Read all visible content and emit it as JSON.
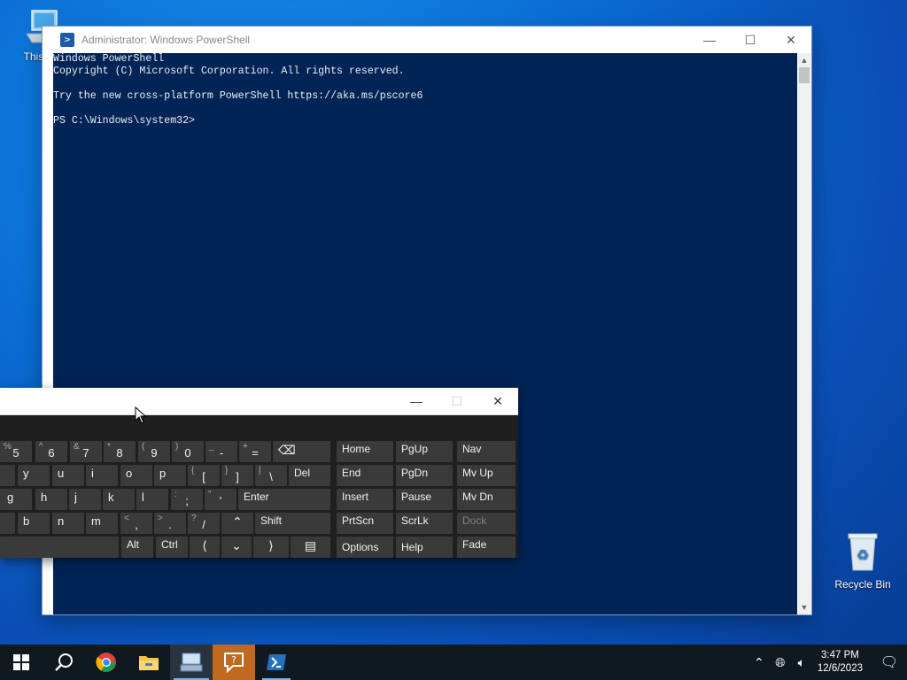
{
  "desktop": {
    "icons": [
      {
        "label": "This PC"
      },
      {
        "label": "Recycle Bin"
      }
    ]
  },
  "powershell": {
    "title": "Administrator: Windows PowerShell",
    "lines": [
      "Windows PowerShell",
      "Copyright (C) Microsoft Corporation. All rights reserved.",
      "",
      "Try the new cross-platform PowerShell https://aka.ms/pscore6",
      "",
      "PS C:\\Windows\\system32>"
    ]
  },
  "osk": {
    "keys": {
      "k5": {
        "shift": "%",
        "main": "5"
      },
      "k6": {
        "shift": "^",
        "main": "6"
      },
      "k7": {
        "shift": "&",
        "main": "7"
      },
      "k8": {
        "shift": "*",
        "main": "8"
      },
      "k9": {
        "shift": "(",
        "main": "9"
      },
      "k0": {
        "shift": ")",
        "main": "0"
      },
      "kminus": {
        "shift": "_",
        "main": "-"
      },
      "kequal": {
        "shift": "+",
        "main": "="
      },
      "y": "y",
      "u": "u",
      "i": "i",
      "o": "o",
      "p": "p",
      "kbrl": {
        "shift": "{",
        "main": "["
      },
      "kbrr": {
        "shift": "}",
        "main": "]"
      },
      "kbsl": {
        "shift": "|",
        "main": "\\"
      },
      "del": "Del",
      "g": "g",
      "h": "h",
      "j": "j",
      "k": "k",
      "l": "l",
      "ksemi": {
        "shift": ":",
        "main": ";"
      },
      "kquote": {
        "shift": "\"",
        "main": "'"
      },
      "enter": "Enter",
      "b": "b",
      "n": "n",
      "m": "m",
      "kcomma": {
        "shift": "<",
        "main": ","
      },
      "kperiod": {
        "shift": ">",
        "main": "."
      },
      "kslash": {
        "shift": "?",
        "main": "/"
      },
      "shift": "Shift",
      "alt": "Alt",
      "ctrl": "Ctrl",
      "home": "Home",
      "pgup": "PgUp",
      "nav": "Nav",
      "end": "End",
      "pgdn": "PgDn",
      "mvup": "Mv Up",
      "insert": "Insert",
      "pause": "Pause",
      "mvdn": "Mv Dn",
      "prtscn": "PrtScn",
      "scrlk": "ScrLk",
      "dock": "Dock",
      "options": "Options",
      "help": "Help",
      "fade": "Fade"
    }
  },
  "taskbar": {
    "clock_time": "3:47 PM",
    "clock_date": "12/6/2023"
  }
}
